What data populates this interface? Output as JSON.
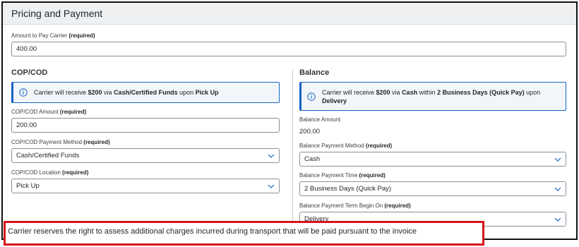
{
  "section": {
    "title": "Pricing and Payment"
  },
  "amount_to_pay": {
    "label": "Amount to Pay Carrier",
    "required": "(required)",
    "value": "400.00"
  },
  "cop": {
    "title": "COP/COD",
    "info_parts": [
      "Carrier will receive ",
      "$200",
      " via ",
      "Cash/Certified Funds",
      " upon ",
      "Pick Up"
    ],
    "amount": {
      "label": "COP/COD Amount",
      "required": "(required)",
      "value": "200.00"
    },
    "payment_method": {
      "label": "COP/COD Payment Method",
      "required": "(required)",
      "value": "Cash/Certified Funds"
    },
    "location": {
      "label": "COP/COD Location",
      "required": "(required)",
      "value": "Pick Up"
    }
  },
  "balance": {
    "title": "Balance",
    "info_parts": [
      "Carrier will receive ",
      "$200",
      " via ",
      "Cash",
      " within ",
      "2 Business Days (Quick Pay)",
      " upon ",
      "Delivery"
    ],
    "amount": {
      "label": "Balance Amount",
      "value": "200.00"
    },
    "payment_method": {
      "label": "Balance Payment Method",
      "required": "(required)",
      "value": "Cash"
    },
    "payment_time": {
      "label": "Balance Payment Time",
      "required": "(required)",
      "value": "2 Business Days (Quick Pay)"
    },
    "term_begin": {
      "label": "Balance Payment Term Begin On",
      "required": "(required)",
      "value": "Delivery"
    }
  },
  "notice": {
    "text": "Carrier reserves the right to assess additional charges incurred during transport that will be paid pursuant to the invoice"
  },
  "icons": {
    "info": "info-circle-icon",
    "chevron": "chevron-down-icon"
  },
  "colors": {
    "accent": "#1764c0",
    "highlight_border": "#d4161b",
    "header_bg": "#eef0f2"
  }
}
